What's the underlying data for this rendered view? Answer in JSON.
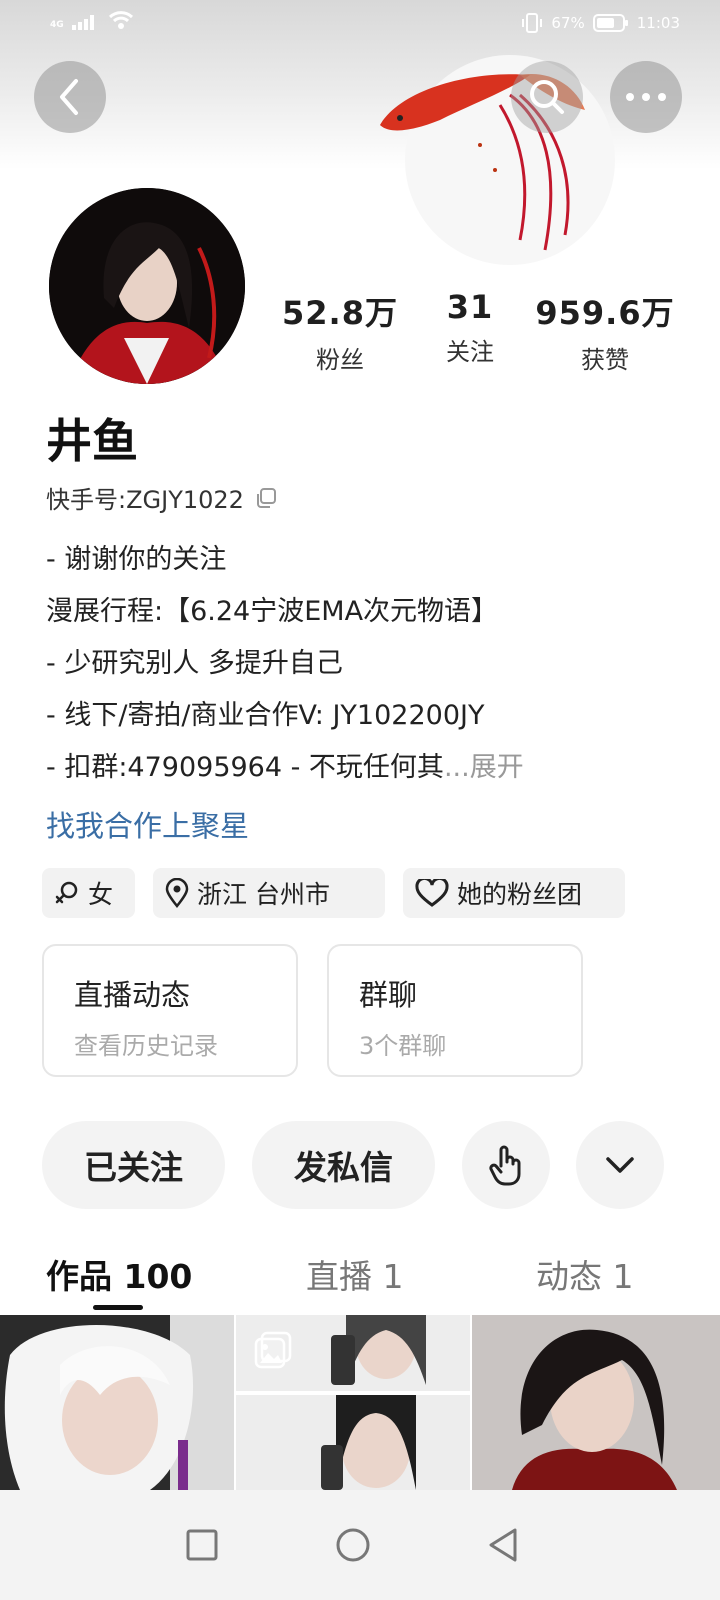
{
  "status_bar": {
    "network": "4G",
    "battery": "67%",
    "time": "11:03"
  },
  "profile": {
    "nickname": "井鱼",
    "kuaishou_id": "快手号:ZGJY1022",
    "stats": [
      {
        "value": "52.8万",
        "label": "粉丝"
      },
      {
        "value": "31",
        "label": "关注"
      },
      {
        "value": "959.6万",
        "label": "获赞"
      }
    ],
    "bio": [
      "- 谢谢你的关注",
      "漫展行程:【6.24宁波EMA次元物语】",
      "- 少研究别人 多提升自己",
      "- 线下/寄拍/商业合作V: JY102200JY",
      "- 扣群:479095964 - 不玩任何其"
    ],
    "bio_ellipsis": "...",
    "expand_label": "展开",
    "star_link": "找我合作上聚星",
    "tags": {
      "gender": "女",
      "location": "浙江 台州市",
      "fan_group": "她的粉丝团"
    }
  },
  "cards": {
    "live": {
      "title": "直播动态",
      "subtitle": "查看历史记录"
    },
    "group": {
      "title": "群聊",
      "subtitle": "3个群聊"
    }
  },
  "actions": {
    "followed": "已关注",
    "message": "发私信"
  },
  "tabs": [
    {
      "label": "作品 100",
      "active": true
    },
    {
      "label": "直播 1",
      "active": false
    },
    {
      "label": "动态 1",
      "active": false
    }
  ],
  "icons": {
    "back": "back-arrow-icon",
    "search": "search-icon",
    "more": "more-dots-icon",
    "copy": "copy-icon",
    "gender": "female-icon",
    "location": "location-pin-icon",
    "fan_group": "heart-icon",
    "poke": "hand-tap-icon",
    "dropdown": "chevron-down-icon",
    "album": "album-icon"
  },
  "colors": {
    "link": "#3a6ea5",
    "button_bg": "#f3f3f3",
    "muted_text": "#999999"
  }
}
